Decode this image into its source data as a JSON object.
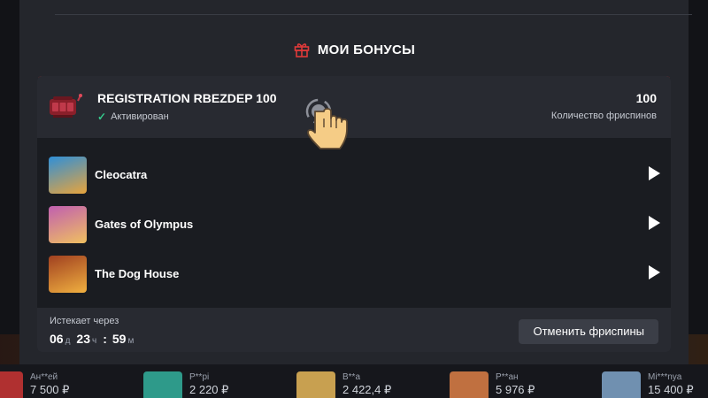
{
  "modal": {
    "title": "МОИ БОНУСЫ",
    "icon": "gift-icon"
  },
  "bonus": {
    "name": "REGISTRATION RBEZDEP 100",
    "status": "Активирован",
    "freespins_count": "100",
    "freespins_label": "Количество фриспинов",
    "games": [
      {
        "name": "Cleocatra",
        "thumb_colors": [
          "#2f8fd8",
          "#e8a43c"
        ]
      },
      {
        "name": "Gates of Olympus",
        "thumb_colors": [
          "#c05fb0",
          "#f0c060"
        ]
      },
      {
        "name": "The Dog House",
        "thumb_colors": [
          "#a04020",
          "#f0b040"
        ]
      }
    ],
    "expires_label": "Истекает через",
    "timer": {
      "days": "06",
      "days_unit": "д",
      "hours": "23",
      "hours_unit": "ч",
      "sep": ":",
      "minutes": "59",
      "minutes_unit": "м"
    },
    "cancel_label": "Отменить фриспины"
  },
  "winners": [
    {
      "name": "Ан**ей",
      "sum": "7 500 ₽",
      "color": "#b03030"
    },
    {
      "name": "Р**pi",
      "sum": "2 220 ₽",
      "color": "#2e9a8a"
    },
    {
      "name": "В**а",
      "sum": "2 422,4 ₽",
      "color": "#c8a050"
    },
    {
      "name": "Р**ан",
      "sum": "5 976 ₽",
      "color": "#c07040"
    },
    {
      "name": "Mi***nya",
      "sum": "15 400 ₽",
      "color": "#7090b0"
    }
  ],
  "colors": {
    "accent": "#d12c2c",
    "status_ok": "#34c98b"
  }
}
